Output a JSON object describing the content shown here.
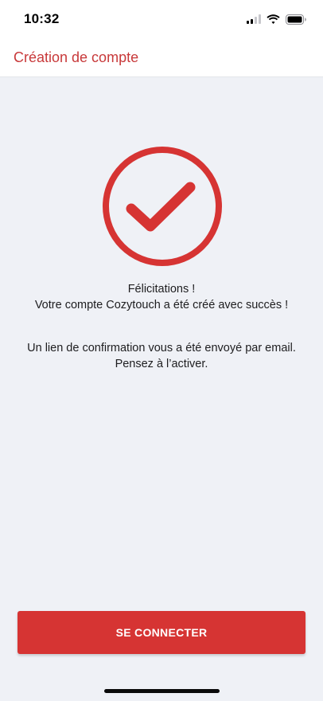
{
  "status_bar": {
    "time": "10:32",
    "icons": [
      "cellular-signal-icon",
      "wifi-icon",
      "battery-icon"
    ]
  },
  "nav": {
    "title": "Création de compte"
  },
  "main": {
    "success_icon": "check-circle-icon",
    "congrats_line1": "Félicitations !",
    "congrats_line2": "Votre compte Cozytouch a été créé avec succès !",
    "confirm_line1": "Un lien de confirmation vous a été envoyé par email.",
    "confirm_line2": "Pensez à l’activer."
  },
  "actions": {
    "connect_label": "SE CONNECTER"
  },
  "colors": {
    "accent": "#d63433",
    "title": "#c8393a",
    "background": "#eff1f6"
  }
}
